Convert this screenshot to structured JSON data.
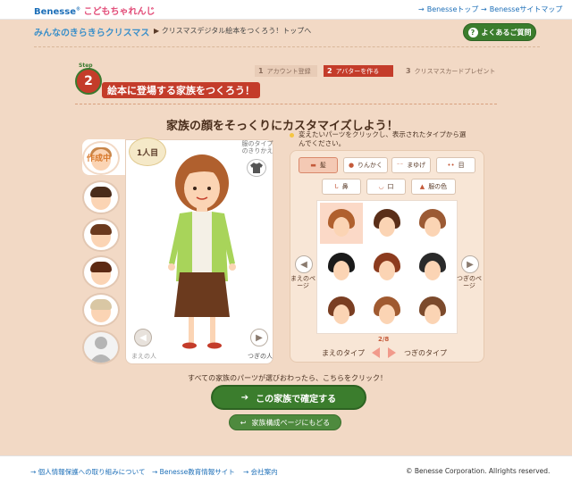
{
  "header": {
    "brand": "Benesse",
    "brand_sub": "こどもちゃれんじ",
    "links": [
      "Benesseトップ",
      "Benesseサイトマップ"
    ]
  },
  "subheader": {
    "logo": "みんなのきらきらクリスマス",
    "breadcrumb": "クリスマスデジタル絵本をつくろう！トップへ",
    "faq_button": "よくあるご質問"
  },
  "steps": {
    "step_word": "Step",
    "step_number": "2",
    "items": [
      {
        "num": "1",
        "label": "アカウント登録"
      },
      {
        "num": "2",
        "label": "アバターを作る"
      },
      {
        "num": "3",
        "label": "クリスマスカードプレゼント"
      }
    ]
  },
  "page_title": "絵本に登場する家族をつくろう！",
  "headline": "家族の顔をそっくりにカスタマイズしよう！",
  "family_tabs": {
    "current_label": "作成中",
    "person_label": "1人目"
  },
  "avatar_panel": {
    "outfit_change_label": "服のタイプのきりかえ",
    "prev_person": "まえの人",
    "next_person": "つぎの人"
  },
  "instruction": "変えたいパーツをクリックし、表示されたタイプから選んでください。",
  "parts_tabs": [
    {
      "label": "髪",
      "icon": "hair-icon",
      "active": true
    },
    {
      "label": "りんかく",
      "icon": "face-outline-icon",
      "active": false
    },
    {
      "label": "まゆげ",
      "icon": "eyebrow-icon",
      "active": false
    },
    {
      "label": "目",
      "icon": "eye-icon",
      "active": false
    },
    {
      "label": "鼻",
      "icon": "nose-icon",
      "active": false
    },
    {
      "label": "口",
      "icon": "mouth-icon",
      "active": false
    },
    {
      "label": "服の色",
      "icon": "clothes-icon",
      "active": false
    }
  ],
  "hair_options": [
    {
      "color": "#b0602e",
      "selected": true
    },
    {
      "color": "#5a2e18",
      "selected": false
    },
    {
      "color": "#9b5a34",
      "selected": false
    },
    {
      "color": "#1a1a1a",
      "selected": false
    },
    {
      "color": "#8c3b1e",
      "selected": false
    },
    {
      "color": "#2a2a2a",
      "selected": false
    },
    {
      "color": "#7a3e22",
      "selected": false
    },
    {
      "color": "#a05a30",
      "selected": false
    },
    {
      "color": "#7c4a2c",
      "selected": false
    }
  ],
  "pager": {
    "prev_page": "まえのページ",
    "next_page": "つぎのページ",
    "type_indicator": "2/8",
    "prev_type": "まえのタイプ",
    "next_type": "つぎのタイプ"
  },
  "actions": {
    "note": "すべての家族のパーツが選びおわったら、こちらをクリック！",
    "confirm": "この家族で確定する",
    "back": "家族構成ページにもどる"
  },
  "footer": {
    "links": [
      "個人情報保護への取り組みについて",
      "Benesse教育情報サイト",
      "会社案内"
    ],
    "copyright": "© Benesse Corporation. Allrights reserved."
  },
  "colors": {
    "accent_red": "#c43c2a",
    "accent_green": "#3b7d2d",
    "background": "#f2d9c5",
    "link_blue": "#1d6fb8"
  }
}
